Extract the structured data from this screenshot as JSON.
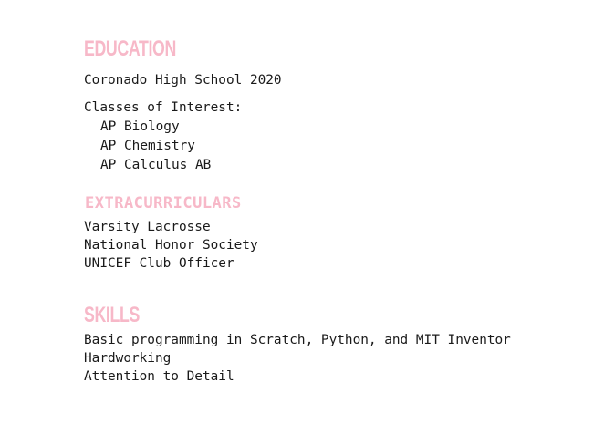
{
  "education": {
    "heading": "EDUCATION",
    "school": "Coronado High School 2020",
    "classes_label": "Classes of Interest:",
    "classes": [
      "AP Biology",
      "AP Chemistry",
      "AP Calculus AB"
    ]
  },
  "extracurriculars": {
    "heading": "EXTRACURRICULARS",
    "items": [
      "Varsity Lacrosse",
      "National Honor Society",
      "UNICEF Club Officer"
    ]
  },
  "skills": {
    "heading": "SKILLS",
    "items": [
      "Basic programming in Scratch, Python, and MIT Inventor",
      "Hardworking",
      "Attention to Detail"
    ]
  },
  "colors": {
    "heading_pink": "#f7b8c8",
    "body_text": "#1a1a1a"
  }
}
